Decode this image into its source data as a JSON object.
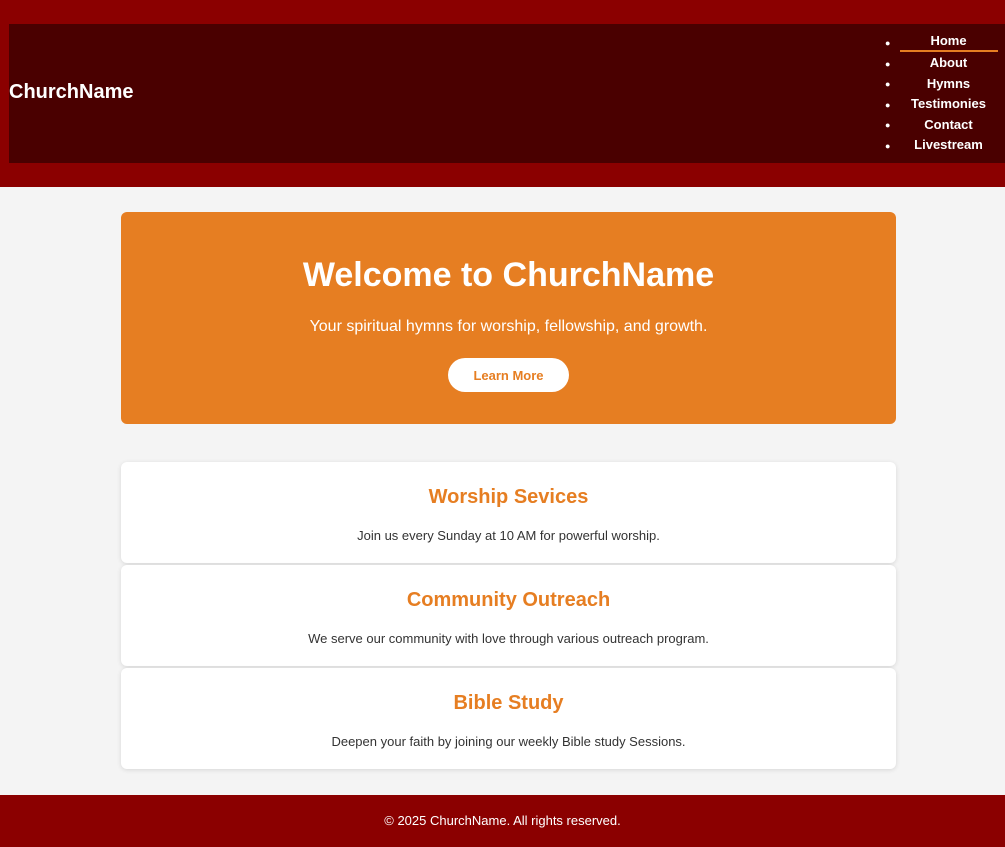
{
  "header": {
    "logo": "ChurchName",
    "nav": [
      {
        "label": "Home",
        "active": true
      },
      {
        "label": "About"
      },
      {
        "label": "Hymns"
      },
      {
        "label": "Testimonies"
      },
      {
        "label": "Contact"
      },
      {
        "label": "Livestream"
      }
    ]
  },
  "hero": {
    "title": "Welcome to ChurchName",
    "subtitle": "Your spiritual hymns for worship, fellowship, and growth.",
    "button_label": "Learn More"
  },
  "cards": [
    {
      "title": "Worship Sevices",
      "text": "Join us every Sunday at 10 AM for powerful worship."
    },
    {
      "title": "Community Outreach",
      "text": "We serve our community with love through various outreach program."
    },
    {
      "title": "Bible Study",
      "text": "Deepen your faith by joining our weekly Bible study Sessions."
    }
  ],
  "footer": {
    "text": "© 2025 ChurchName. All rights reserved."
  },
  "colors": {
    "header_bg": "#8b0000",
    "nav_bg": "#4a0000",
    "accent": "#e67e22",
    "page_bg": "#f4f4f4",
    "footer_bg": "#8b0000"
  }
}
